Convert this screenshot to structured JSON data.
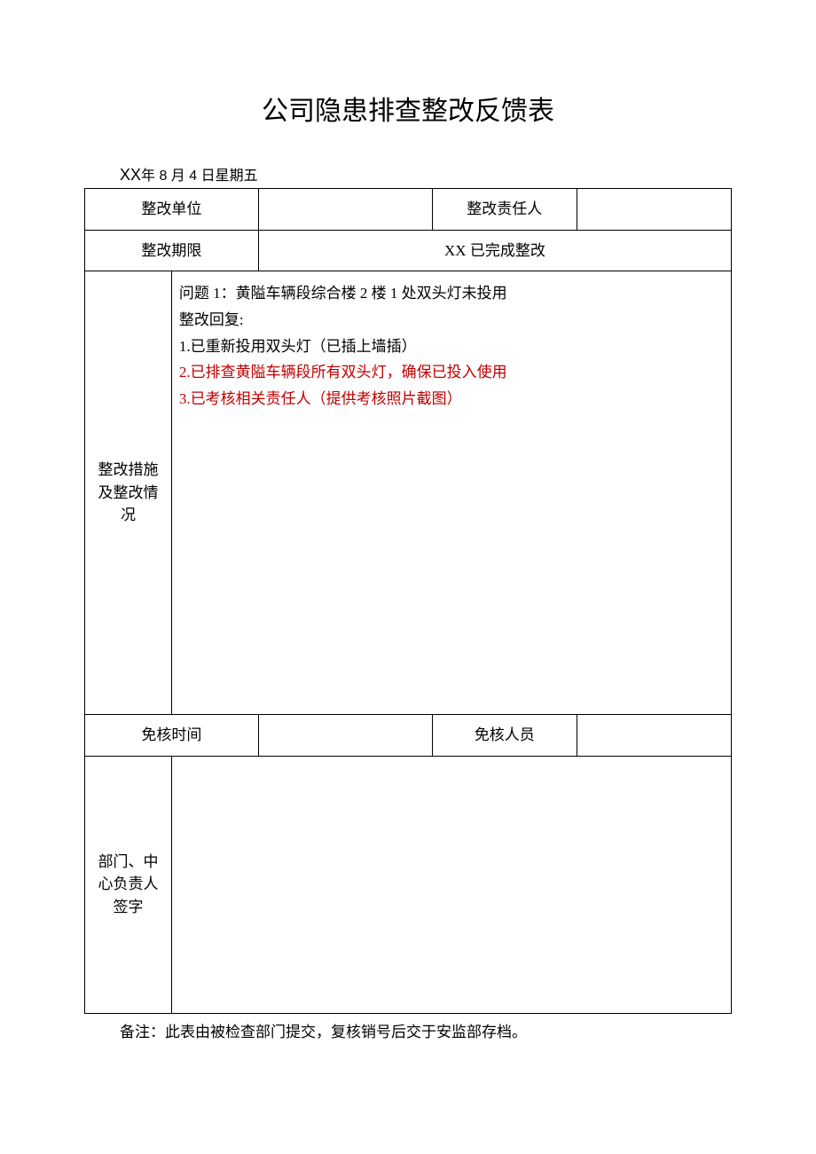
{
  "title": "公司隐患排查整改反馈表",
  "date_prefix": "XX",
  "date_rest": "年 8 月 4 日星期五",
  "row1": {
    "unit_label": "整改单位",
    "unit_value": "",
    "resp_label": "整改责任人",
    "resp_value": ""
  },
  "row2": {
    "deadline_label": "整改期限",
    "deadline_value": "XX 已完成整改"
  },
  "detail": {
    "side_label": "整改措施及整改情况",
    "lines": {
      "q": "问题 1：黄隘车辆段综合楼 2 楼 1 处双头灯未投用",
      "r0": "整改回复:",
      "r1": "1.已重新投用双头灯（已插上墙插）",
      "r2": "2.已排查黄隘车辆段所有双头灯，确保已投入使用",
      "r3": "3.已考核相关责任人（提供考核照片截图）"
    }
  },
  "row4": {
    "time_label": "免核时间",
    "time_value": "",
    "person_label": "免核人员",
    "person_value": ""
  },
  "row5": {
    "sig_label": "部门、中心负责人签字",
    "sig_value": ""
  },
  "note": "备注：此表由被检查部门提交，复核销号后交于安监部存档。"
}
